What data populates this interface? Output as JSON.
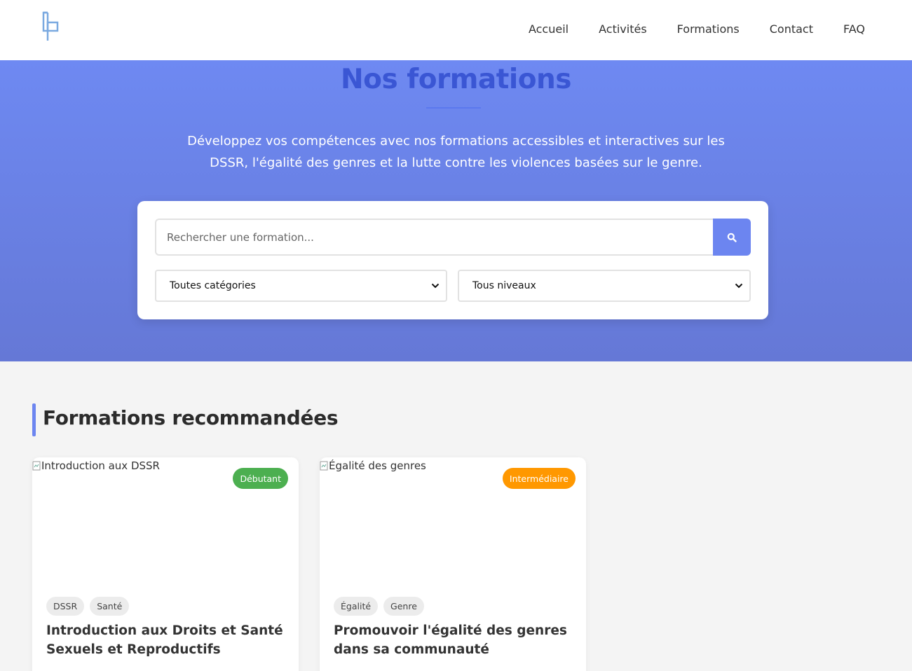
{
  "nav": {
    "items": [
      {
        "label": "Accueil"
      },
      {
        "label": "Activités"
      },
      {
        "label": "Formations"
      },
      {
        "label": "Contact"
      },
      {
        "label": "FAQ"
      }
    ]
  },
  "hero": {
    "title": "Nos formations",
    "subtitle": "Développez vos compétences avec nos formations accessibles et interactives sur les DSSR, l'égalité des genres et la lutte contre les violences basées sur le genre.",
    "search_placeholder": "Rechercher une formation...",
    "category_select": "Toutes catégories",
    "level_select": "Tous niveaux"
  },
  "section": {
    "title": "Formations recommandées"
  },
  "cards": [
    {
      "image_alt": "Introduction aux DSSR",
      "level": "Débutant",
      "level_color": "#4caf50",
      "tags": [
        "DSSR",
        "Santé"
      ],
      "title": "Introduction aux Droits et Santé Sexuels et Reproductifs"
    },
    {
      "image_alt": "Égalité des genres",
      "level": "Intermédiaire",
      "level_color": "#ff9800",
      "tags": [
        "Égalité",
        "Genre"
      ],
      "title": "Promouvoir l'égalité des genres dans sa communauté"
    }
  ],
  "colors": {
    "accent": "#6c85f0",
    "title_blue": "#3a56d4",
    "hero_top": "#6e89f2",
    "hero_bottom": "#6578d6"
  }
}
